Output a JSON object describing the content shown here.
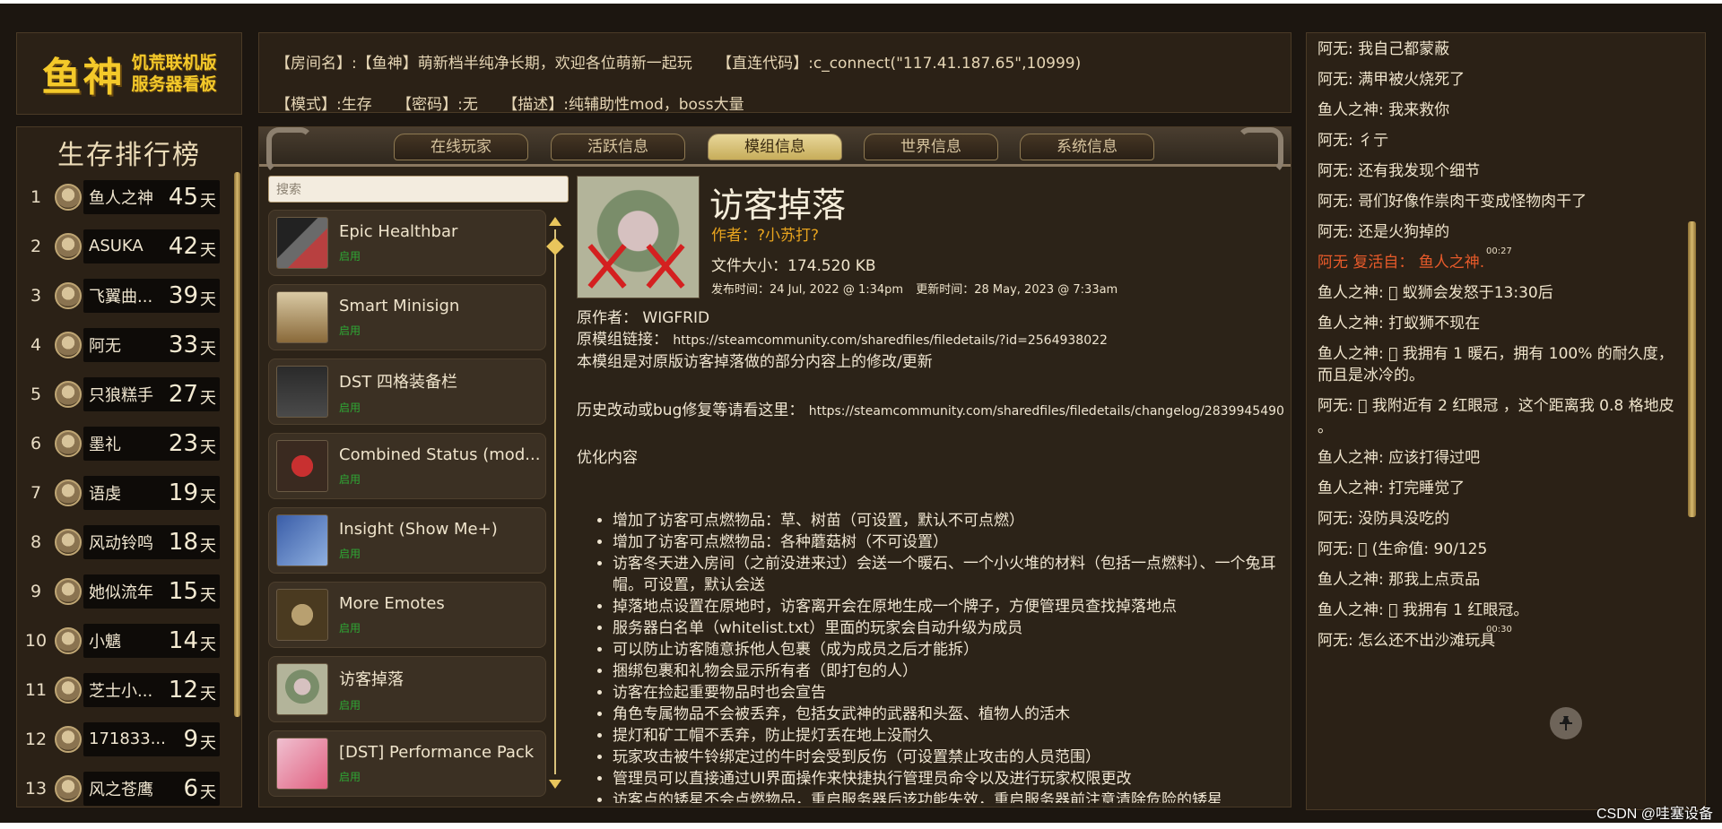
{
  "logo": {
    "big": "鱼神",
    "line1": "饥荒联机版",
    "line2": "服务器看板"
  },
  "info": {
    "room": "【房间名】:【鱼神】萌新档半纯净长期，欢迎各位萌新一起玩",
    "connect": "【直连代码】:c_connect(\"117.41.187.65\",10999)",
    "mode": "【模式】:生存",
    "password": "【密码】:无",
    "desc": "【描述】:纯辅助性mod，boss大量"
  },
  "ranking": {
    "title": "生存排行榜",
    "unit": "天",
    "rows": [
      {
        "rank": "1",
        "name": "鱼人之神",
        "days": "45"
      },
      {
        "rank": "2",
        "name": "ASUKA",
        "days": "42"
      },
      {
        "rank": "3",
        "name": "飞翼曲...",
        "days": "39"
      },
      {
        "rank": "4",
        "name": "阿无",
        "days": "33"
      },
      {
        "rank": "5",
        "name": "只狼糕手",
        "days": "27"
      },
      {
        "rank": "6",
        "name": "墨礼",
        "days": "23"
      },
      {
        "rank": "7",
        "name": "语虔",
        "days": "19"
      },
      {
        "rank": "8",
        "name": "风动铃鸣",
        "days": "18"
      },
      {
        "rank": "9",
        "name": "她似流年",
        "days": "15"
      },
      {
        "rank": "10",
        "name": "小魑",
        "days": "14"
      },
      {
        "rank": "11",
        "name": "芝士小...",
        "days": "12"
      },
      {
        "rank": "12",
        "name": "171833...",
        "days": "9"
      },
      {
        "rank": "13",
        "name": "风之苍鹰",
        "days": "6"
      }
    ]
  },
  "tabs": [
    "在线玩家",
    "活跃信息",
    "模组信息",
    "世界信息",
    "系统信息"
  ],
  "active_tab": "模组信息",
  "search": {
    "placeholder": "搜索"
  },
  "mods": [
    {
      "name": "Epic Healthbar",
      "status": "启用"
    },
    {
      "name": "Smart Minisign",
      "status": "启用"
    },
    {
      "name": "DST 四格装备栏",
      "status": "启用"
    },
    {
      "name": "Combined Status (mod...",
      "status": "启用"
    },
    {
      "name": "Insight (Show Me+)",
      "status": "启用"
    },
    {
      "name": "More Emotes",
      "status": "启用"
    },
    {
      "name": "访客掉落",
      "status": "启用"
    },
    {
      "name": "[DST] Performance Pack",
      "status": "启用"
    }
  ],
  "detail": {
    "title": "访客掉落",
    "author": "作者：?小苏打?",
    "size": "文件大小：174.520 KB",
    "published": "发布时间：24 Jul, 2022 @ 1:34pm",
    "updated": "更新时间：28 May, 2023 @ 7:33am",
    "orig_author": "原作者： WIGFRID",
    "orig_link_label": "原模组链接：",
    "orig_link": "https://steamcommunity.com/sharedfiles/filedetails/?id=2564938022",
    "intro": "本模组是对原版访客掉落做的部分内容上的修改/更新",
    "changelog_label": "历史改动或bug修复等请看这里：",
    "changelog_link": "https://steamcommunity.com/sharedfiles/filedetails/changelog/2839945490",
    "optimize": "优化内容",
    "bullets": [
      "增加了访客可点燃物品：草、树苗（可设置，默认不可点燃）",
      "增加了访客可点燃物品：各种蘑菇树（不可设置）",
      "访客冬天进入房间（之前没进来过）会送一个暖石、一个小火堆的材料（包括一点燃料）、一个兔耳帽。可设置，默认会送",
      "掉落地点设置在原地时，访客离开会在原地生成一个牌子，方便管理员查找掉落地点",
      "服务器白名单（whitelist.txt）里面的玩家会自动升级为成员",
      "可以防止访客随意拆他人包裹（成为成员之后才能拆）",
      "捆绑包裹和礼物会显示所有者（即打包的人）",
      "访客在捡起重要物品时也会宣告",
      "角色专属物品不会被丢弃，包括女武神的武器和头盔、植物人的活木",
      "提灯和矿工帽不丢弃，防止提灯丢在地上没耐久",
      "玩家攻击被牛铃绑定过的牛时会受到反伤（可设置禁止攻击的人员范围）",
      "管理员可以直接通过UI界面操作来快捷执行管理员命令以及进行玩家权限更改",
      "访客点的矮星不会点燃物品，重启服务器后该功能失效，重启服务器前注意清除危险的矮星"
    ]
  },
  "chat": [
    {
      "text": "阿无: 我自己都蒙蔽"
    },
    {
      "text": "阿无: 满甲被火烧死了"
    },
    {
      "text": "鱼人之神: 我来救你"
    },
    {
      "text": "阿无: 彳亍"
    },
    {
      "text": "阿无: 还有我发现个细节"
    },
    {
      "text": "阿无: 哥们好像作祟肉干变成怪物肉干了"
    },
    {
      "text": "阿无: 还是火狗掉的"
    },
    {
      "text": "阿无 复活自： 鱼人之神.",
      "ts": "00:27",
      "revive": true
    },
    {
      "text": "鱼人之神: 󰀀 蚁狮会发怒于13:30后"
    },
    {
      "text": "鱼人之神: 打蚁狮不现在"
    },
    {
      "text": "鱼人之神: 󰀀 我拥有 1 暖石，拥有 100% 的耐久度，而且是冰冷的。"
    },
    {
      "text": "阿无: 󰀀 我附近有 2 红眼冠 ，这个距离我 0.8 格地皮 。"
    },
    {
      "text": "鱼人之神: 应该打得过吧"
    },
    {
      "text": "鱼人之神: 打完睡觉了"
    },
    {
      "text": "阿无: 没防具没吃的"
    },
    {
      "text": "阿无: 󰀀 (生命值: 90/125"
    },
    {
      "text": "鱼人之神: 那我上点贡品"
    },
    {
      "text": "鱼人之神: 󰀀 我拥有 1 红眼冠。"
    },
    {
      "text": "阿无: 怎么还不出沙滩玩具",
      "ts": "00:30"
    }
  ],
  "icons": {
    "pin": "pin-icon"
  },
  "watermark": "CSDN @哇塞设备"
}
